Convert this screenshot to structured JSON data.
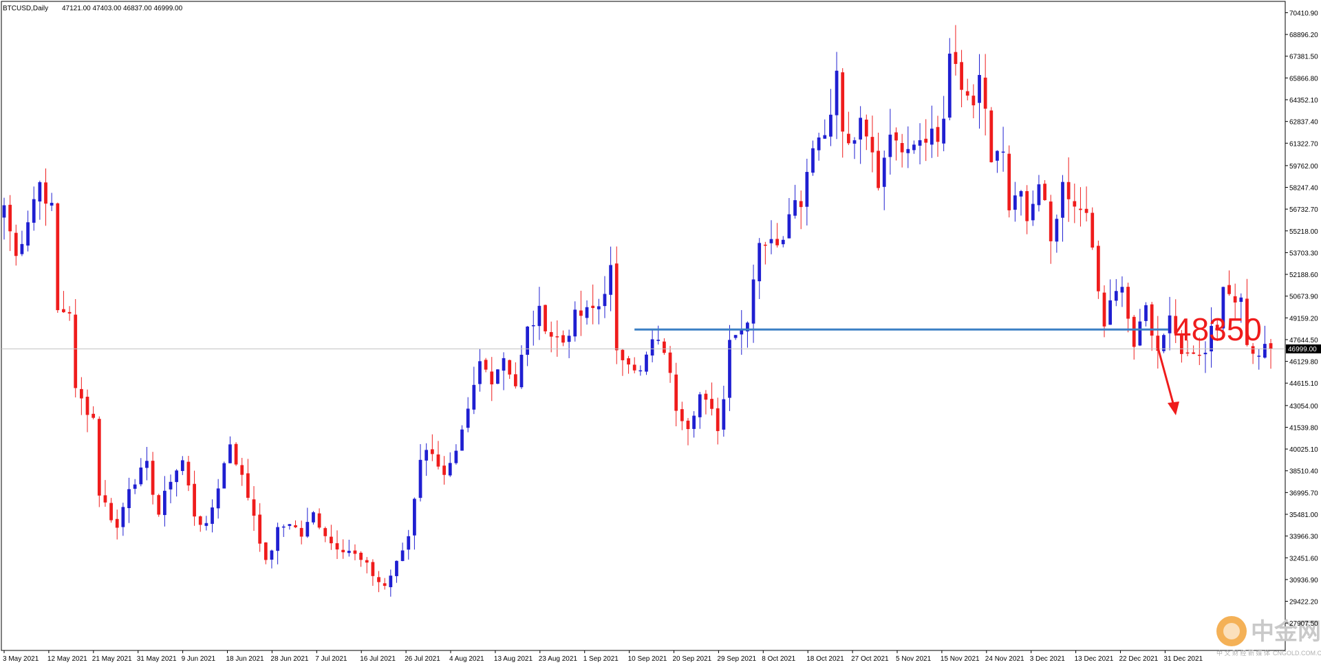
{
  "header": {
    "symbol": "BTCUSD,Daily",
    "ohlc": "47121.00 47403.00 46837.00 46999.00"
  },
  "current_price_label": "46999.00",
  "annotation": {
    "level_text": "48350",
    "level_value": 48350
  },
  "watermark": {
    "brand": "中金网",
    "url": "CNGOLD.COM.CN",
    "tagline": "中 文 财 经 新 媒 体"
  },
  "colors": {
    "bull": "#1f1fd1",
    "bear": "#ef1c1c",
    "level_line": "#3a7fc4",
    "arrow": "#ef1c1c",
    "grid": "#c8c8c8"
  },
  "chart_data": {
    "type": "candlestick",
    "y_range": [
      26000,
      71200
    ],
    "y_ticks": [
      "70410.90",
      "68896.20",
      "67381.50",
      "65866.80",
      "64352.10",
      "62837.40",
      "61322.70",
      "59762.00",
      "58247.40",
      "56732.70",
      "55218.00",
      "53703.30",
      "52188.60",
      "50673.90",
      "49159.20",
      "47644.50",
      "46129.80",
      "44615.10",
      "43054.00",
      "41539.80",
      "40025.10",
      "38510.40",
      "36995.70",
      "35481.00",
      "33966.30",
      "32451.60",
      "30936.90",
      "29422.20",
      "27907.50"
    ],
    "x_ticks": [
      "3 May 2021",
      "12 May 2021",
      "21 May 2021",
      "31 May 2021",
      "9 Jun 2021",
      "18 Jun 2021",
      "28 Jun 2021",
      "7 Jul 2021",
      "16 Jul 2021",
      "26 Jul 2021",
      "4 Aug 2021",
      "13 Aug 2021",
      "23 Aug 2021",
      "1 Sep 2021",
      "10 Sep 2021",
      "20 Sep 2021",
      "29 Sep 2021",
      "8 Oct 2021",
      "18 Oct 2021",
      "27 Oct 2021",
      "5 Nov 2021",
      "15 Nov 2021",
      "24 Nov 2021",
      "3 Dec 2021",
      "13 Dec 2021",
      "22 Dec 2021",
      "31 Dec 2021"
    ],
    "anchors": [
      {
        "d": 0,
        "p": 57000
      },
      {
        "d": 2,
        "p": 53400
      },
      {
        "d": 5,
        "p": 57500
      },
      {
        "d": 6,
        "p": 58600
      },
      {
        "d": 8,
        "p": 56700
      },
      {
        "d": 9,
        "p": 49600
      },
      {
        "d": 11,
        "p": 49700
      },
      {
        "d": 12,
        "p": 44000
      },
      {
        "d": 15,
        "p": 42200
      },
      {
        "d": 16,
        "p": 37000
      },
      {
        "d": 19,
        "p": 34500
      },
      {
        "d": 21,
        "p": 37500
      },
      {
        "d": 24,
        "p": 38800
      },
      {
        "d": 26,
        "p": 35500
      },
      {
        "d": 28,
        "p": 38000
      },
      {
        "d": 30,
        "p": 39200
      },
      {
        "d": 32,
        "p": 35500
      },
      {
        "d": 34,
        "p": 34500
      },
      {
        "d": 36,
        "p": 37500
      },
      {
        "d": 38,
        "p": 40500
      },
      {
        "d": 40,
        "p": 38000
      },
      {
        "d": 42,
        "p": 35500
      },
      {
        "d": 44,
        "p": 32000
      },
      {
        "d": 46,
        "p": 34300
      },
      {
        "d": 48,
        "p": 35000
      },
      {
        "d": 50,
        "p": 34000
      },
      {
        "d": 52,
        "p": 35500
      },
      {
        "d": 55,
        "p": 33500
      },
      {
        "d": 58,
        "p": 33000
      },
      {
        "d": 61,
        "p": 31800
      },
      {
        "d": 63,
        "p": 30800
      },
      {
        "d": 64,
        "p": 30500
      },
      {
        "d": 66,
        "p": 32000
      },
      {
        "d": 68,
        "p": 34000
      },
      {
        "d": 70,
        "p": 39500
      },
      {
        "d": 72,
        "p": 40000
      },
      {
        "d": 74,
        "p": 38000
      },
      {
        "d": 76,
        "p": 39500
      },
      {
        "d": 78,
        "p": 42500
      },
      {
        "d": 80,
        "p": 46000
      },
      {
        "d": 82,
        "p": 45000
      },
      {
        "d": 84,
        "p": 46500
      },
      {
        "d": 86,
        "p": 44500
      },
      {
        "d": 88,
        "p": 48300
      },
      {
        "d": 90,
        "p": 49500
      },
      {
        "d": 92,
        "p": 48000
      },
      {
        "d": 94,
        "p": 47500
      },
      {
        "d": 96,
        "p": 49200
      },
      {
        "d": 98,
        "p": 49500
      },
      {
        "d": 100,
        "p": 50000
      },
      {
        "d": 102,
        "p": 52500
      },
      {
        "d": 103,
        "p": 46500
      },
      {
        "d": 105,
        "p": 46400
      },
      {
        "d": 107,
        "p": 45300
      },
      {
        "d": 109,
        "p": 47500
      },
      {
        "d": 111,
        "p": 47000
      },
      {
        "d": 113,
        "p": 43000
      },
      {
        "d": 115,
        "p": 41800
      },
      {
        "d": 117,
        "p": 43800
      },
      {
        "d": 119,
        "p": 42500
      },
      {
        "d": 120,
        "p": 41600
      },
      {
        "d": 121,
        "p": 43500
      },
      {
        "d": 122,
        "p": 48100
      },
      {
        "d": 124,
        "p": 48300
      },
      {
        "d": 125,
        "p": 49300
      },
      {
        "d": 127,
        "p": 54700
      },
      {
        "d": 129,
        "p": 54300
      },
      {
        "d": 131,
        "p": 55000
      },
      {
        "d": 132,
        "p": 57000
      },
      {
        "d": 134,
        "p": 57400
      },
      {
        "d": 136,
        "p": 61500
      },
      {
        "d": 138,
        "p": 62000
      },
      {
        "d": 139,
        "p": 64000
      },
      {
        "d": 140,
        "p": 66000
      },
      {
        "d": 141,
        "p": 62200
      },
      {
        "d": 142,
        "p": 61000
      },
      {
        "d": 144,
        "p": 62500
      },
      {
        "d": 146,
        "p": 60500
      },
      {
        "d": 147,
        "p": 58500
      },
      {
        "d": 149,
        "p": 62500
      },
      {
        "d": 150,
        "p": 61000
      },
      {
        "d": 152,
        "p": 61500
      },
      {
        "d": 154,
        "p": 61800
      },
      {
        "d": 156,
        "p": 62200
      },
      {
        "d": 157,
        "p": 61500
      },
      {
        "d": 158,
        "p": 63200
      },
      {
        "d": 159,
        "p": 67500
      },
      {
        "d": 161,
        "p": 65000
      },
      {
        "d": 163,
        "p": 64500
      },
      {
        "d": 164,
        "p": 65500
      },
      {
        "d": 165,
        "p": 63500
      },
      {
        "d": 166,
        "p": 60000
      },
      {
        "d": 168,
        "p": 60500
      },
      {
        "d": 169,
        "p": 56700
      },
      {
        "d": 171,
        "p": 57500
      },
      {
        "d": 172,
        "p": 56000
      },
      {
        "d": 174,
        "p": 58200
      },
      {
        "d": 175,
        "p": 57000
      },
      {
        "d": 176,
        "p": 54000
      },
      {
        "d": 178,
        "p": 58000
      },
      {
        "d": 180,
        "p": 56500
      },
      {
        "d": 182,
        "p": 57000
      },
      {
        "d": 183,
        "p": 53500
      },
      {
        "d": 185,
        "p": 48400
      },
      {
        "d": 186,
        "p": 50500
      },
      {
        "d": 188,
        "p": 51000
      },
      {
        "d": 190,
        "p": 47200
      },
      {
        "d": 192,
        "p": 49800
      },
      {
        "d": 194,
        "p": 47000
      },
      {
        "d": 195,
        "p": 48000
      },
      {
        "d": 196,
        "p": 48800
      },
      {
        "d": 198,
        "p": 47000
      },
      {
        "d": 199,
        "p": 46500
      },
      {
        "d": 200,
        "p": 47000
      },
      {
        "d": 202,
        "p": 46700
      },
      {
        "d": 203,
        "p": 48800
      },
      {
        "d": 204,
        "p": 48800
      },
      {
        "d": 205,
        "p": 50800
      },
      {
        "d": 206,
        "p": 50800
      },
      {
        "d": 208,
        "p": 50700
      },
      {
        "d": 209,
        "p": 47600
      },
      {
        "d": 210,
        "p": 46500
      },
      {
        "d": 212,
        "p": 47100
      },
      {
        "d": 213,
        "p": 46999
      }
    ],
    "first_date": "3 May 2021",
    "last_close": 46999,
    "horizontal_level": 48350,
    "level_start_date": "10 Sep 2021",
    "grid": false
  }
}
